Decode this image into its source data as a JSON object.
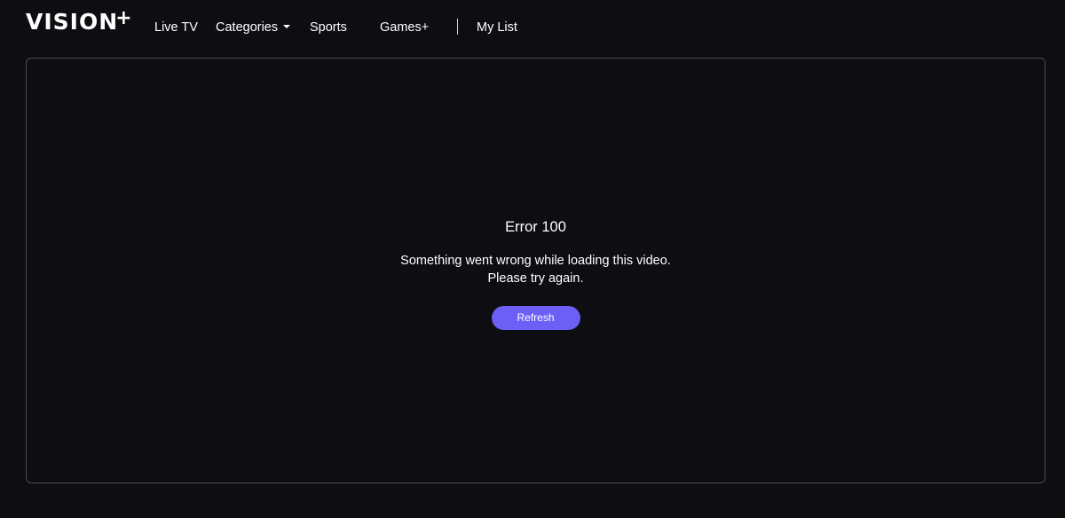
{
  "app": {
    "logo_text": "VISION",
    "logo_plus": "+"
  },
  "nav": {
    "items": [
      {
        "label": "Live TV"
      },
      {
        "label": "Categories",
        "has_dropdown": true
      },
      {
        "label": "Sports"
      },
      {
        "label": "Games+"
      },
      {
        "label": "My List"
      }
    ]
  },
  "error": {
    "title": "Error 100",
    "message_line1": "Something went wrong while loading this video.",
    "message_line2": "Please try again.",
    "button_label": "Refresh"
  },
  "colors": {
    "background": "#0e0d12",
    "accent": "#6b5ff6",
    "border": "#4a4a52"
  }
}
